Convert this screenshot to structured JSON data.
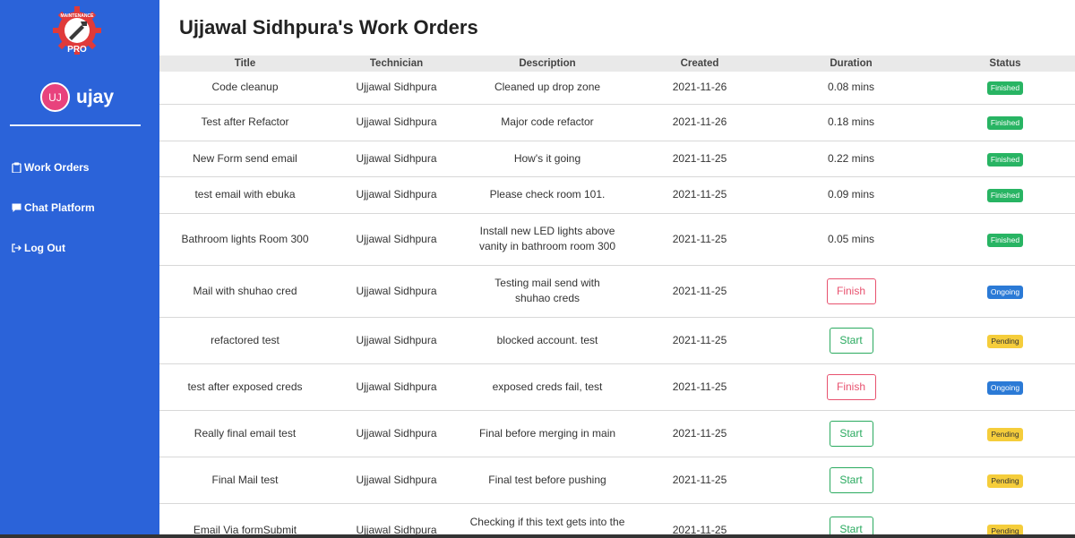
{
  "sidebar": {
    "logo": {
      "top_text": "MAINTENANCE",
      "bottom_text": "PRO",
      "color": "#e03a3a"
    },
    "user": {
      "initials": "UJ",
      "name": "ujay",
      "avatar_color": "#e8427d"
    },
    "nav": [
      {
        "label": "Work Orders",
        "icon": "clipboard-icon"
      },
      {
        "label": "Chat Platform",
        "icon": "chat-icon"
      },
      {
        "label": "Log Out",
        "icon": "logout-icon"
      }
    ],
    "bg_color": "#2b63d9"
  },
  "page": {
    "title": "Ujjawal Sidhpura's Work Orders"
  },
  "table": {
    "headers": [
      "Title",
      "Technician",
      "Description",
      "Created",
      "Duration",
      "Status"
    ],
    "rows": [
      {
        "title": "Code cleanup",
        "technician": "Ujjawal Sidhpura",
        "description": "Cleaned up drop zone",
        "created": "2021-11-26",
        "duration": "0.08 mins",
        "status": "Finished"
      },
      {
        "title": "Test after Refactor",
        "technician": "Ujjawal Sidhpura",
        "description": "Major code refactor",
        "created": "2021-11-26",
        "duration": "0.18 mins",
        "status": "Finished"
      },
      {
        "title": "New Form send email",
        "technician": "Ujjawal Sidhpura",
        "description": "How's it going",
        "created": "2021-11-25",
        "duration": "0.22 mins",
        "status": "Finished"
      },
      {
        "title": "test email with ebuka",
        "technician": "Ujjawal Sidhpura",
        "description": "Please check room 101.",
        "created": "2021-11-25",
        "duration": "0.09 mins",
        "status": "Finished"
      },
      {
        "title": "Bathroom lights Room 300",
        "technician": "Ujjawal Sidhpura",
        "description": "Install new LED lights above vanity in bathroom room 300",
        "created": "2021-11-25",
        "duration": "0.05 mins",
        "status": "Finished"
      },
      {
        "title": "Mail with shuhao cred",
        "technician": "Ujjawal Sidhpura",
        "description": "Testing mail send with shuhao creds",
        "created": "2021-11-25",
        "action": "Finish",
        "status": "Ongoing"
      },
      {
        "title": "refactored test",
        "technician": "Ujjawal Sidhpura",
        "description": "blocked account. test",
        "created": "2021-11-25",
        "action": "Start",
        "status": "Pending"
      },
      {
        "title": "test after exposed creds",
        "technician": "Ujjawal Sidhpura",
        "description": "exposed creds fail, test",
        "created": "2021-11-25",
        "action": "Finish",
        "status": "Ongoing"
      },
      {
        "title": "Really final email test",
        "technician": "Ujjawal Sidhpura",
        "description": "Final before merging in main",
        "created": "2021-11-25",
        "action": "Start",
        "status": "Pending"
      },
      {
        "title": "Final Mail test",
        "technician": "Ujjawal Sidhpura",
        "description": "Final test before pushing",
        "created": "2021-11-25",
        "action": "Start",
        "status": "Pending"
      },
      {
        "title": "Email Via formSubmit",
        "technician": "Ujjawal Sidhpura",
        "description": "Checking if this text gets into the",
        "created": "2021-11-25",
        "action": "Start",
        "status": "Pending"
      }
    ]
  },
  "colors": {
    "finished": "#28b463",
    "ongoing": "#2b7ad6",
    "pending": "#f5cd3b",
    "finish_button": "#e8526f",
    "start_button": "#2aaa5f"
  }
}
